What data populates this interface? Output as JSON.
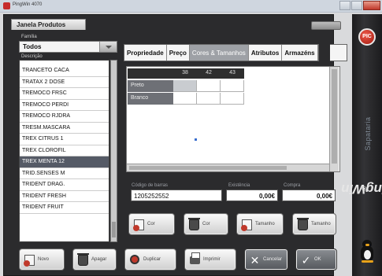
{
  "window": {
    "title": "PingWin 4070"
  },
  "panel": {
    "tab_label": "Janela Produtos",
    "category_label": "Família",
    "category_value": "Todos",
    "list_label": "Descrição"
  },
  "products": [
    "TRANCETO CACA",
    "TRATAX 2 DOSE",
    "TREMOCO FRSC",
    "TREMOCO PERDI",
    "TREMOCO RJDRA",
    "TRESM.MASCARA",
    "TREX CITRUS 1",
    "TREX CLOROFIL",
    "TREX MENTA 12",
    "TRID.SENSES M",
    "TRIDENT DRAG.",
    "TRIDENT FRESH",
    "TRIDENT FRUIT"
  ],
  "selected_product": "TREX MENTA 12",
  "tabs": [
    {
      "label": "Propriedade",
      "active": false
    },
    {
      "label": "Preço",
      "active": false
    },
    {
      "label": "Cores & Tamanhos",
      "active": true
    },
    {
      "label": "Atributos",
      "active": false
    },
    {
      "label": "Armazéns",
      "active": false
    }
  ],
  "grid": {
    "columns": [
      "38",
      "42",
      "43"
    ],
    "rows": [
      "Preto",
      "Branco"
    ]
  },
  "fields": {
    "barcode_label": "Código de barras",
    "barcode_value": "1205252552",
    "stock_label": "Existência",
    "stock_value": "0,00€",
    "buy_label": "Compra",
    "buy_value": "0,00€"
  },
  "grid_buttons": {
    "add_color": "Cor",
    "delete_color": "Cor",
    "add_size": "Tamanho",
    "delete_size": "Tamanho"
  },
  "bottom_buttons": {
    "new": "Novo",
    "delete": "Apagar",
    "duplicate": "Duplicar",
    "print": "Imprimir",
    "cancel": "Cancelar",
    "ok": "OK"
  },
  "brand": {
    "logo_text": "PIC",
    "subtitle": "Sapataria",
    "name": "PingWin",
    "registered": "®"
  },
  "colors": {
    "accent_red": "#c0392b",
    "dark_panel": "#2b2b2d",
    "selected_row": "#555a66",
    "active_tab": "#9ea1a6"
  }
}
